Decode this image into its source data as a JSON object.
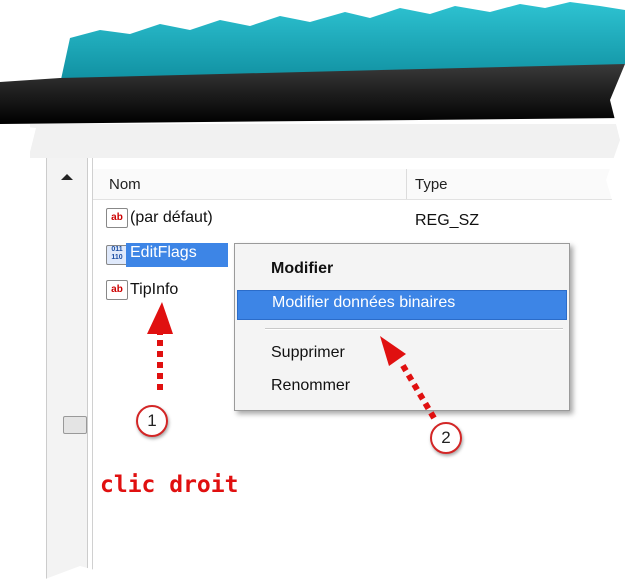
{
  "columns": {
    "name": "Nom",
    "type": "Type"
  },
  "values": [
    {
      "name": "(par défaut)",
      "type": "REG_SZ",
      "icon": "string-value-icon"
    },
    {
      "name": "EditFlags",
      "type": "",
      "icon": "binary-value-icon"
    },
    {
      "name": "TipInfo",
      "type": "",
      "icon": "string-value-icon"
    }
  ],
  "context_menu": {
    "modify": "Modifier",
    "modify_binary": "Modifier données binaires",
    "delete": "Supprimer",
    "rename": "Renommer"
  },
  "annotations": {
    "step1": "1",
    "step2": "2",
    "caption": "clic droit"
  },
  "icons": {
    "string_glyph": "ab",
    "binary_glyph": "011 110"
  },
  "colors": {
    "annotation_red": "#e01010",
    "menu_highlight": "#3d85e6",
    "selection": "#3d85e6",
    "banner_teal": "#1fa8b9"
  }
}
